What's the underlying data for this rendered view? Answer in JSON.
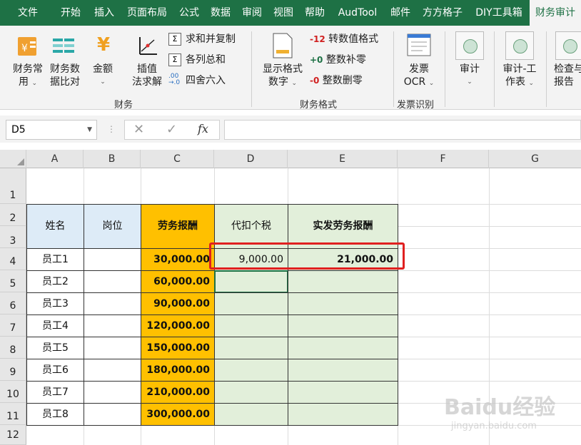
{
  "ribbon_tabs": [
    "文件",
    "开始",
    "插入",
    "页面布局",
    "公式",
    "数据",
    "审阅",
    "视图",
    "帮助",
    "AudTool",
    "邮件",
    "方方格子",
    "DIY工具箱",
    "财务审计"
  ],
  "active_tab": "财务审计",
  "ribbon": {
    "group1": {
      "btn_cw_common": [
        "财务常",
        "用"
      ],
      "btn_cw_compare": [
        "财务数",
        "据比对"
      ],
      "btn_amount": "金额",
      "btn_interp": [
        "插值",
        "法求解"
      ],
      "small": [
        "求和并复制",
        "各列总和",
        "四舍六入"
      ],
      "label": "财务"
    },
    "group2": {
      "btn_display": [
        "显示格式",
        "数字"
      ],
      "small": [
        {
          "prefix": "-12",
          "label": "转数值格式"
        },
        {
          "prefix": "+0",
          "label": "整数补零"
        },
        {
          "prefix": "-0",
          "label": "整数删零"
        }
      ],
      "label": "财务格式"
    },
    "group3": {
      "btn_ocr": [
        "发票",
        "OCR"
      ],
      "label": "发票识别"
    },
    "group4": {
      "btn_audit": "审计",
      "btn_workpaper": [
        "审计-工",
        "作表"
      ],
      "btn_check": [
        "检查与",
        "报告"
      ]
    }
  },
  "formula_bar": {
    "name_box": "D5",
    "cancel": "✕",
    "confirm": "✓",
    "fx": "fx",
    "formula": ""
  },
  "columns": [
    "A",
    "B",
    "C",
    "D",
    "E",
    "F",
    "G"
  ],
  "rows": [
    "1",
    "2",
    "3",
    "4",
    "5",
    "6",
    "7",
    "8",
    "9",
    "10",
    "11",
    "12"
  ],
  "table": {
    "headers": [
      "姓名",
      "岗位",
      "劳务报酬",
      "代扣个税",
      "实发劳务报酬"
    ],
    "rows": [
      {
        "name": "员工1",
        "pay": "30,000.00",
        "tax": "9,000.00",
        "net": "21,000.00"
      },
      {
        "name": "员工2",
        "pay": "60,000.00",
        "tax": "",
        "net": ""
      },
      {
        "name": "员工3",
        "pay": "90,000.00",
        "tax": "",
        "net": ""
      },
      {
        "name": "员工4",
        "pay": "120,000.00",
        "tax": "",
        "net": ""
      },
      {
        "name": "员工5",
        "pay": "150,000.00",
        "tax": "",
        "net": ""
      },
      {
        "name": "员工6",
        "pay": "180,000.00",
        "tax": "",
        "net": ""
      },
      {
        "name": "员工7",
        "pay": "210,000.00",
        "tax": "",
        "net": ""
      },
      {
        "name": "员工8",
        "pay": "300,000.00",
        "tax": "",
        "net": ""
      }
    ]
  },
  "watermark": {
    "brand": "Baidu经验",
    "url": "jingyan.baidu.com"
  },
  "colors": {
    "excel_green": "#1e7145",
    "orange": "#ffc000",
    "blue": "#ddebf7",
    "green": "#e2efda",
    "highlight_red": "#e02020"
  }
}
